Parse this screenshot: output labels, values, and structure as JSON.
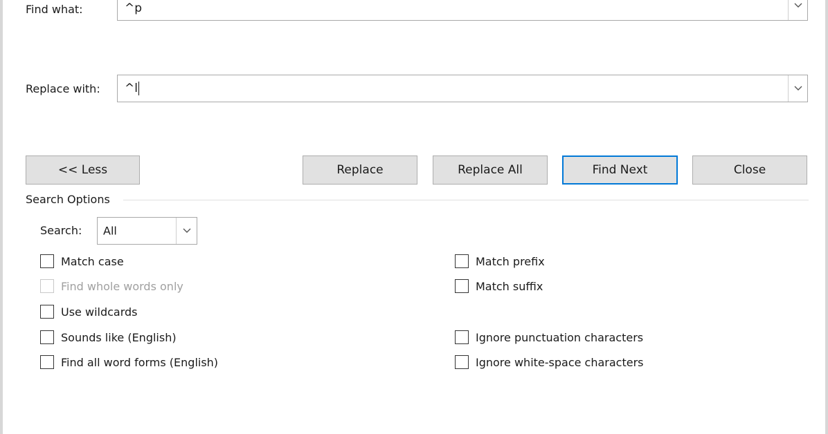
{
  "find": {
    "label": "Find what:",
    "value": "^p"
  },
  "replace": {
    "label": "Replace with:",
    "value": "^l"
  },
  "buttons": {
    "less": "<< Less",
    "replace": "Replace",
    "replace_all": "Replace All",
    "find_next": "Find Next",
    "close": "Close"
  },
  "search_options": {
    "heading": "Search Options",
    "search_label": "Search:",
    "search_value": "All",
    "left": [
      {
        "label": "Match case",
        "checked": false,
        "enabled": true
      },
      {
        "label": "Find whole words only",
        "checked": false,
        "enabled": false
      },
      {
        "label": "Use wildcards",
        "checked": false,
        "enabled": true
      },
      {
        "label": "Sounds like (English)",
        "checked": false,
        "enabled": true
      },
      {
        "label": "Find all word forms (English)",
        "checked": false,
        "enabled": true
      }
    ],
    "right": [
      {
        "label": "Match prefix",
        "checked": false,
        "enabled": true
      },
      {
        "label": "Match suffix",
        "checked": false,
        "enabled": true
      },
      {
        "label": "Ignore punctuation characters",
        "checked": false,
        "enabled": true
      },
      {
        "label": "Ignore white-space characters",
        "checked": false,
        "enabled": true
      }
    ]
  },
  "colors": {
    "default_button_border": "#0078d7",
    "button_face": "#e1e1e1"
  },
  "icons": {
    "dropdown": "chevron-down-icon"
  }
}
